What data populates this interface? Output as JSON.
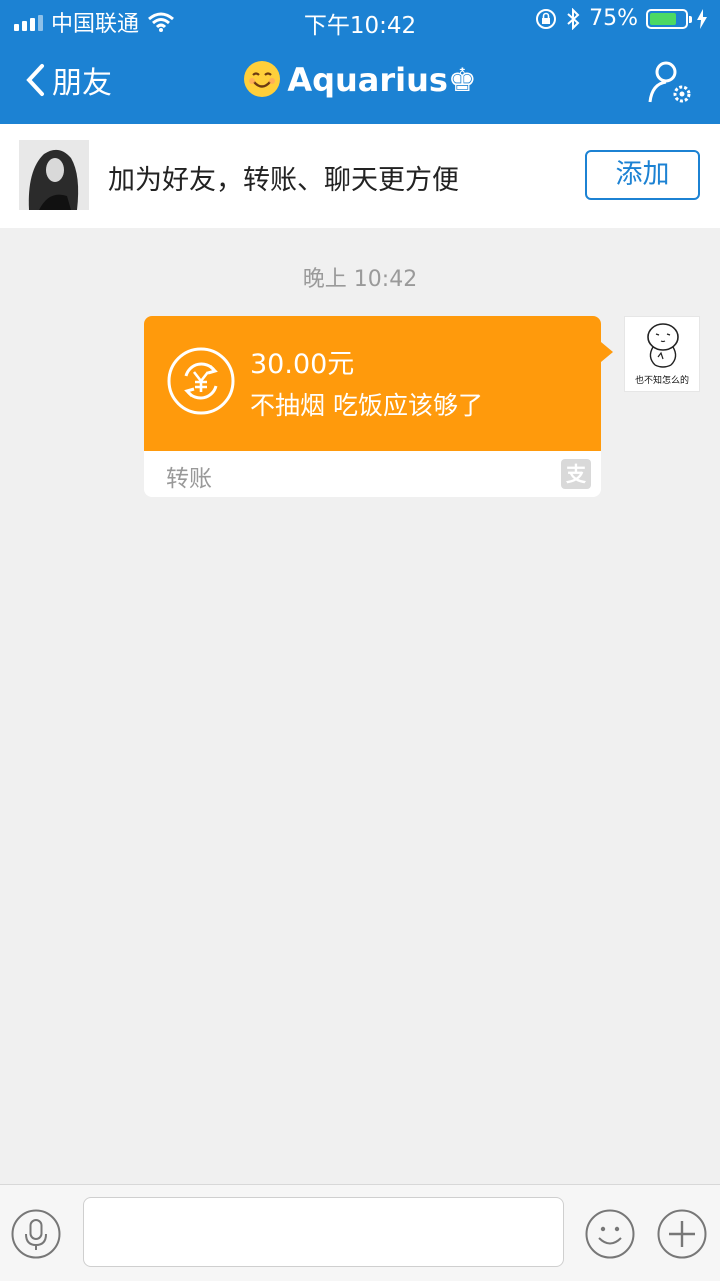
{
  "status_bar": {
    "carrier": "中国联通",
    "time": "下午10:42",
    "battery": "75%",
    "battery_level": 0.75
  },
  "nav": {
    "back_label": "朋友",
    "title": "Aquarius♚"
  },
  "add_friend_bar": {
    "prompt": "加为好友，转账、聊天更方便",
    "button_label": "添加"
  },
  "chat": {
    "timestamp": "晚上 10:42",
    "messages": [
      {
        "type": "transfer",
        "amount": "30.00元",
        "note": "不抽烟 吃饭应该够了",
        "footer_label": "转账",
        "footer_icon": "支",
        "sender_avatar_caption": "也不知怎么的"
      }
    ]
  },
  "colors": {
    "header_blue": "#1c82d3",
    "transfer_orange": "#ff9a0c",
    "background": "#f0f0f0"
  }
}
